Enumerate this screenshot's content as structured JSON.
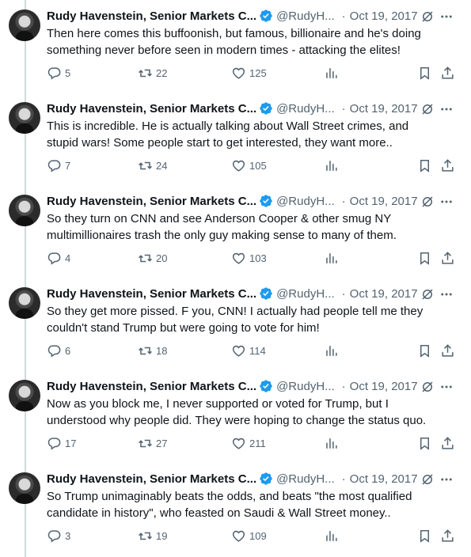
{
  "author": {
    "name": "Rudy Havenstein, Senior Markets C...",
    "handle": "@RudyH...",
    "verified_color": "#1d9bf0"
  },
  "tweets": [
    {
      "date": "Oct 19, 2017",
      "text": "Then here comes this buffoonish, but famous, billionaire and he's doing something never before seen in modern times - attacking the elites!",
      "replies": "5",
      "retweets": "22",
      "likes": "125"
    },
    {
      "date": "Oct 19, 2017",
      "text": "This is incredible. He is actually talking about Wall Street crimes, and stupid wars!  Some people start to get interested, they want more..",
      "replies": "7",
      "retweets": "24",
      "likes": "105"
    },
    {
      "date": "Oct 19, 2017",
      "text": "So they turn on CNN and see Anderson Cooper & other smug NY multimillionaires trash the only guy making sense to many of them.",
      "replies": "4",
      "retweets": "20",
      "likes": "103"
    },
    {
      "date": "Oct 19, 2017",
      "text": "So they get more pissed. F you, CNN! I actually had people tell me they couldn't stand Trump but were going to vote for him!",
      "replies": "6",
      "retweets": "18",
      "likes": "114"
    },
    {
      "date": "Oct 19, 2017",
      "text": "Now as you block me, I never supported or voted for Trump, but I understood why people did. They were hoping to change the status quo.",
      "replies": "17",
      "retweets": "27",
      "likes": "211"
    },
    {
      "date": "Oct 19, 2017",
      "text": "So Trump unimaginably beats the odds, and beats \"the most qualified candidate in history\", who feasted on Saudi & Wall Street money..",
      "replies": "3",
      "retweets": "19",
      "likes": "109"
    }
  ]
}
